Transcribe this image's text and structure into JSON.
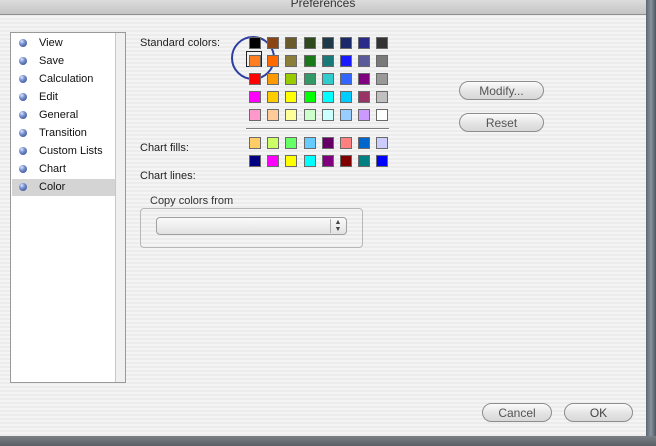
{
  "window": {
    "title": "Preferences"
  },
  "sidebar": {
    "items": [
      {
        "label": "View",
        "selected": false
      },
      {
        "label": "Save",
        "selected": false
      },
      {
        "label": "Calculation",
        "selected": false
      },
      {
        "label": "Edit",
        "selected": false
      },
      {
        "label": "General",
        "selected": false
      },
      {
        "label": "Transition",
        "selected": false
      },
      {
        "label": "Custom Lists",
        "selected": false
      },
      {
        "label": "Chart",
        "selected": false
      },
      {
        "label": "Color",
        "selected": true
      }
    ]
  },
  "color_pane": {
    "standard_colors_label": "Standard colors:",
    "chart_fills_label": "Chart fills:",
    "chart_lines_label": "Chart lines:",
    "standard_colors": [
      [
        "#000000",
        "#8b4513",
        "#6b5a2a",
        "#2e4a1e",
        "#1e3a4a",
        "#1a2a6b",
        "#2a2a8b",
        "#333333"
      ],
      [
        "#ff7f20",
        "#ff6a00",
        "#8b7d3a",
        "#1a7a1a",
        "#1a7a7a",
        "#1a1aff",
        "#5a5a9a",
        "#7a7a7a"
      ],
      [
        "#ff0000",
        "#ff9900",
        "#99cc00",
        "#339966",
        "#33cccc",
        "#3366ff",
        "#800080",
        "#999999"
      ],
      [
        "#ff00ff",
        "#ffcc00",
        "#ffff00",
        "#00ff00",
        "#00ffff",
        "#00ccff",
        "#993366",
        "#c0c0c0"
      ],
      [
        "#ff99cc",
        "#ffcc99",
        "#ffff99",
        "#ccffcc",
        "#ccffff",
        "#99ccff",
        "#cc99ff",
        "#ffffff"
      ]
    ],
    "chart_fills": [
      "#ffcc66",
      "#ccff66",
      "#66ff66",
      "#66ccff",
      "#660066",
      "#ff8080",
      "#0066cc",
      "#ccccff"
    ],
    "chart_lines": [
      "#000080",
      "#ff00ff",
      "#ffff00",
      "#00ffff",
      "#800080",
      "#800000",
      "#008080",
      "#0000ff"
    ],
    "selected_swatch": "#ff7f20",
    "modify_button": "Modify...",
    "reset_button": "Reset",
    "copy_group_title": "Copy colors from",
    "copy_popup_value": ""
  },
  "footer": {
    "cancel_button": "Cancel",
    "ok_button": "OK"
  }
}
